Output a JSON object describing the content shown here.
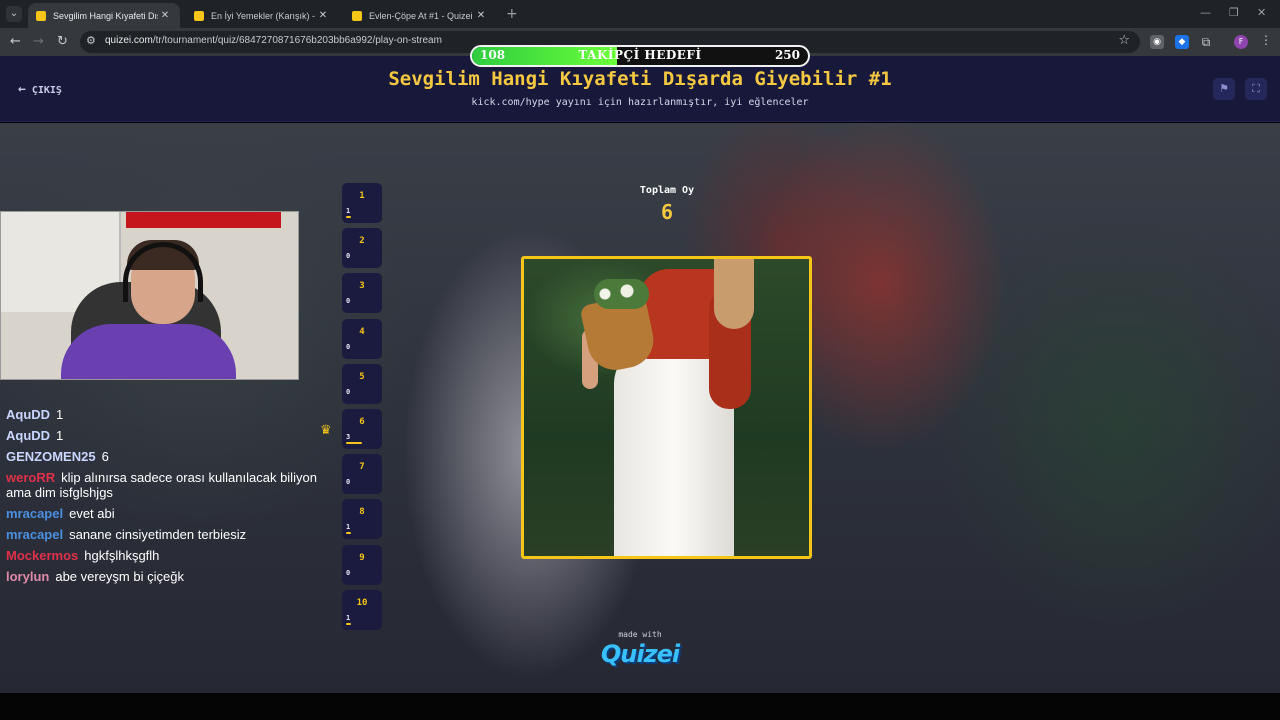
{
  "browser": {
    "tabs": [
      {
        "title": "Sevgilim Hangi Kıyafeti Dışarda",
        "active": true
      },
      {
        "title": "En İyi Yemekler (Karışık) - Quizei",
        "active": false
      },
      {
        "title": "Evlen-Çöpe At #1 - Quizei",
        "active": false
      }
    ],
    "url_host": "quizei.com",
    "url_path": "/tr/tournament/quiz/6847270871676b203bb6a992/play-on-stream",
    "profile_initial": "F"
  },
  "goal": {
    "label": "TAKİPÇİ HEDEFİ",
    "current": "108",
    "target": "250",
    "progress": 0.432
  },
  "header": {
    "exit_label": "ÇIKIŞ",
    "title": "Sevgilim Hangi Kıyafeti Dışarda Giyebilir #1",
    "subtitle": "kick.com/hype yayını için hazırlanmıştır, iyi eğlenceler"
  },
  "chat": [
    {
      "user": "AquDD",
      "text": "1",
      "color": "#c9d6ff"
    },
    {
      "user": "AquDD",
      "text": "1",
      "color": "#c9d6ff"
    },
    {
      "user": "GENZOMEN25",
      "text": "6",
      "color": "#c9d6ff"
    },
    {
      "user": "weroRR",
      "text": "klip alınırsa sadece orası kullanılacak biliyon ama dim isfglshjgs",
      "color": "#e0304a"
    },
    {
      "user": "mracapel",
      "text": "evet abi",
      "color": "#4a8fe0"
    },
    {
      "user": "mracapel",
      "text": "sanane cinsiyetimden terbiesiz",
      "color": "#4a8fe0"
    },
    {
      "user": "Mockermos",
      "text": "hgkfşlhkşgflh",
      "color": "#e0304a"
    },
    {
      "user": "lorylun",
      "text": "abe vereyşm bi çiçeğk",
      "color": "#e08aa8"
    }
  ],
  "options": [
    {
      "num": "1",
      "count": "1",
      "fraction": 0.1667
    },
    {
      "num": "2",
      "count": "0",
      "fraction": 0
    },
    {
      "num": "3",
      "count": "0",
      "fraction": 0
    },
    {
      "num": "4",
      "count": "0",
      "fraction": 0
    },
    {
      "num": "5",
      "count": "0",
      "fraction": 0
    },
    {
      "num": "6",
      "count": "3",
      "fraction": 0.5
    },
    {
      "num": "7",
      "count": "0",
      "fraction": 0
    },
    {
      "num": "8",
      "count": "1",
      "fraction": 0.1667
    },
    {
      "num": "9",
      "count": "0",
      "fraction": 0
    },
    {
      "num": "10",
      "count": "1",
      "fraction": 0.1667
    }
  ],
  "leader_icon": "crown-icon",
  "votes": {
    "label": "Toplam Oy",
    "total": "6"
  },
  "footer": {
    "made_with": "made with",
    "brand": "Quizei"
  },
  "colors": {
    "accent": "#f5c518",
    "header_bg": "#17183a",
    "goal_fill": "#2ecc40"
  }
}
